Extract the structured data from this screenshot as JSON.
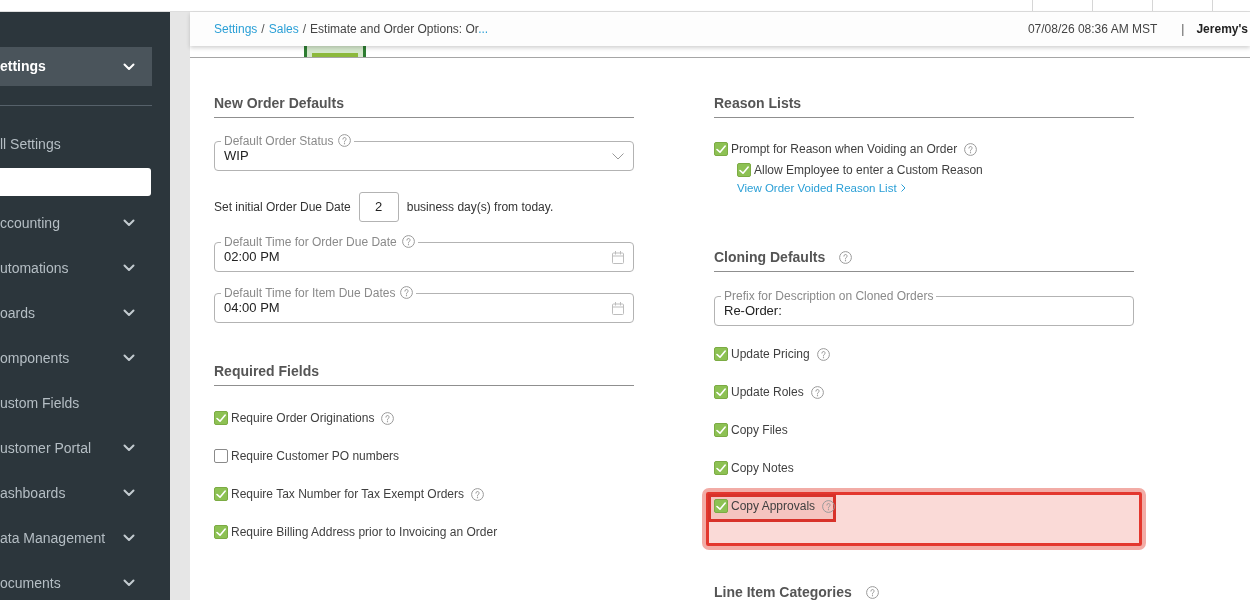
{
  "top_bar": {
    "date_time": "07/08/26 08:36 AM MST",
    "separator": "|",
    "user": "Jeremy's"
  },
  "breadcrumb": {
    "separator": "/",
    "items": [
      {
        "label": "Settings",
        "kind": "link"
      },
      {
        "label": "Sales",
        "kind": "link"
      },
      {
        "label": "Estimate and Order Options: Or",
        "kind": "current"
      }
    ],
    "ellipsis": "..."
  },
  "sidebar": {
    "title": "ettings",
    "expanded": true,
    "all_settings": "ll Settings",
    "items": [
      {
        "label": "ccounting",
        "expandable": true
      },
      {
        "label": "utomations",
        "expandable": true
      },
      {
        "label": "oards",
        "expandable": true
      },
      {
        "label": "omponents",
        "expandable": true
      },
      {
        "label": "ustom Fields",
        "expandable": false
      },
      {
        "label": "ustomer Portal",
        "expandable": true
      },
      {
        "label": "ashboards",
        "expandable": true
      },
      {
        "label": "ata Management",
        "expandable": true
      },
      {
        "label": "ocuments",
        "expandable": true
      }
    ]
  },
  "new_order_defaults": {
    "title": "New Order Defaults",
    "status_field": {
      "label": "Default Order Status",
      "help": true,
      "value": "WIP"
    },
    "due_date": {
      "prefix": "Set initial Order Due Date",
      "value": "2",
      "suffix": "business day(s) from today."
    },
    "time_fields": [
      {
        "label": "Default Time for Order Due Date",
        "help": true,
        "value": "02:00 PM"
      },
      {
        "label": "Default Time for Item Due Dates",
        "help": true,
        "value": "04:00 PM"
      }
    ]
  },
  "required_fields": {
    "title": "Required Fields",
    "options": [
      {
        "label": "Require Order Originations",
        "checked": true,
        "help": true
      },
      {
        "label": "Require Customer PO numbers",
        "checked": false,
        "help": false
      },
      {
        "label": "Require Tax Number for Tax Exempt Orders",
        "checked": true,
        "help": true
      },
      {
        "label": "Require Billing Address prior to Invoicing an Order",
        "checked": true,
        "help": false
      }
    ]
  },
  "reason_lists": {
    "title": "Reason Lists",
    "options": [
      {
        "label": "Prompt for Reason when Voiding an Order",
        "checked": true,
        "help": true,
        "children": [
          {
            "label": "Allow Employee to enter a Custom Reason",
            "checked": true,
            "help": false
          }
        ]
      }
    ],
    "link": "View Order Voided Reason List"
  },
  "cloning_defaults": {
    "title": "Cloning Defaults",
    "help": true,
    "prefix_field": {
      "label": "Prefix for Description on Cloned Orders",
      "help": false,
      "value": "Re-Order:"
    },
    "options": [
      {
        "label": "Update Pricing",
        "checked": true,
        "help": true,
        "highlighted": false
      },
      {
        "label": "Update Roles",
        "checked": true,
        "help": true,
        "highlighted": false
      },
      {
        "label": "Copy Files",
        "checked": true,
        "help": false,
        "highlighted": false
      },
      {
        "label": "Copy Notes",
        "checked": true,
        "help": false,
        "highlighted": false
      },
      {
        "label": "Copy Approvals",
        "checked": true,
        "help": true,
        "highlighted": true
      }
    ]
  },
  "line_item_categories": {
    "title": "Line Item Categories",
    "help": true
  }
}
